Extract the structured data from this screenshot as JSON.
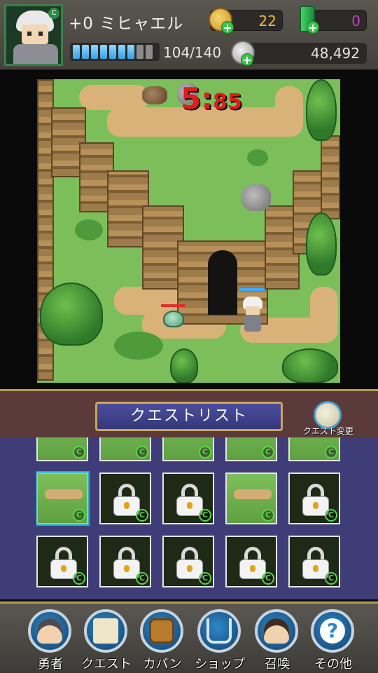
{
  "header": {
    "player_name": "+0 ミヒャエル",
    "avatar_badge": "C",
    "coins": "22",
    "gems": "0",
    "stamina_text": "104/140",
    "stamina_level": 0.74,
    "silver": "48,492",
    "plus_symbol": "+"
  },
  "map": {
    "timer_minutes": "5",
    "timer_colon": ":",
    "timer_seconds": "85"
  },
  "quest_panel": {
    "title": "クエストリスト",
    "change_label": "クエスト変更",
    "clear_mark": "C",
    "tiles": [
      {
        "state": "cleared",
        "selected": false
      },
      {
        "state": "cleared",
        "selected": false
      },
      {
        "state": "cleared",
        "selected": false
      },
      {
        "state": "cleared",
        "selected": false
      },
      {
        "state": "cleared",
        "selected": false
      },
      {
        "state": "cleared",
        "selected": true
      },
      {
        "state": "locked",
        "selected": false
      },
      {
        "state": "locked",
        "selected": false
      },
      {
        "state": "cleared",
        "selected": false
      },
      {
        "state": "locked",
        "selected": false
      },
      {
        "state": "locked",
        "selected": false
      },
      {
        "state": "locked",
        "selected": false
      },
      {
        "state": "locked",
        "selected": false
      },
      {
        "state": "locked",
        "selected": false
      },
      {
        "state": "locked",
        "selected": false
      }
    ]
  },
  "nav": {
    "hero": "勇者",
    "quest": "クエスト",
    "bag": "カバン",
    "shop": "ショップ",
    "summon": "召喚",
    "other": "その他",
    "other_icon_glyph": "?"
  },
  "colors": {
    "timer": "#e21b1b",
    "panel_bg": "#3f3d78",
    "selected_tile": "#4fe3f2",
    "gold_frame": "#c9a55d"
  }
}
